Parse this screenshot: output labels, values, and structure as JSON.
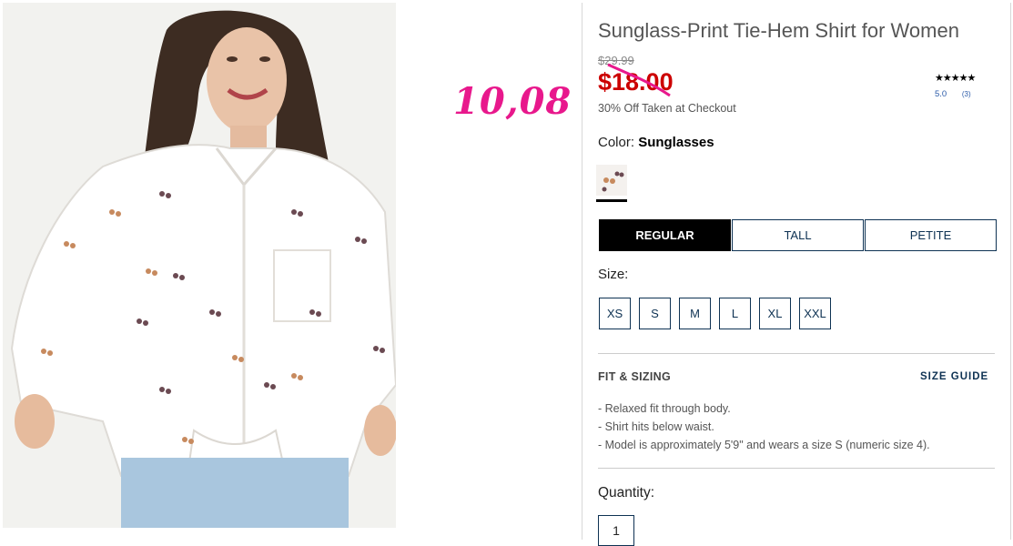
{
  "annotation": {
    "text": "10,08",
    "color": "#e8188c"
  },
  "product": {
    "title": "Sunglass-Print Tie-Hem Shirt for Women",
    "original_price": "$29.99",
    "sale_price": "$18.00",
    "promo": "30% Off Taken at Checkout",
    "rating": {
      "stars": "★★★★★",
      "score": "5.0",
      "count": "(3)"
    },
    "color": {
      "label": "Color:",
      "value": "Sunglasses"
    },
    "fit_tabs": [
      {
        "label": "REGULAR",
        "active": true
      },
      {
        "label": "TALL",
        "active": false
      },
      {
        "label": "PETITE",
        "active": false
      }
    ],
    "size_label": "Size:",
    "sizes": [
      "XS",
      "S",
      "M",
      "L",
      "XL",
      "XXL"
    ],
    "fit_heading": "FIT & SIZING",
    "size_guide": "SIZE GUIDE",
    "fit_details": [
      "Relaxed fit through body.",
      "Shirt hits below waist.",
      "Model is approximately 5'9\" and wears a size S (numeric size 4)."
    ],
    "quantity_label": "Quantity:",
    "quantity_value": "1"
  },
  "colors": {
    "sale": "#cc0000",
    "navy": "#0e3253",
    "annotation": "#e8188c"
  }
}
